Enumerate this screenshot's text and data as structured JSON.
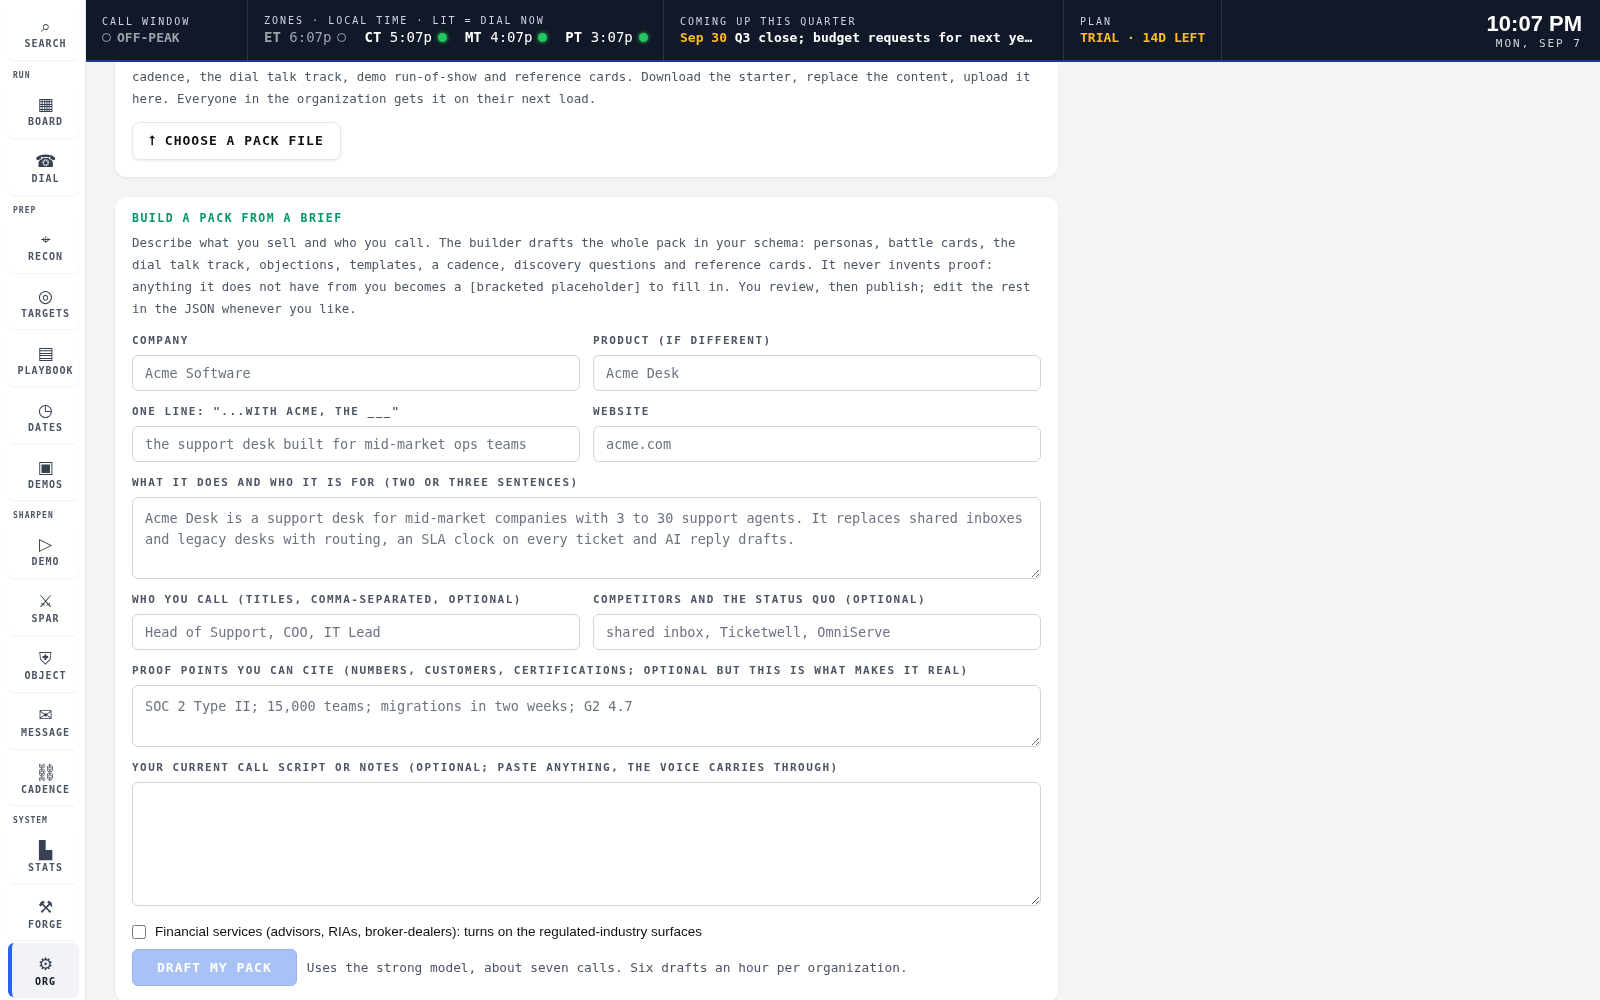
{
  "sidebar": {
    "search": {
      "icon": "⌕",
      "label": "SEARCH"
    },
    "sections": [
      {
        "title": "RUN",
        "items": [
          {
            "icon": "▦",
            "label": "BOARD",
            "selected": false
          },
          {
            "icon": "☎",
            "label": "DIAL",
            "selected": false
          }
        ]
      },
      {
        "title": "PREP",
        "items": [
          {
            "icon": "⌖",
            "label": "RECON",
            "selected": false
          },
          {
            "icon": "◎",
            "label": "TARGETS",
            "selected": false
          },
          {
            "icon": "▤",
            "label": "PLAYBOOK",
            "selected": false
          },
          {
            "icon": "◷",
            "label": "DATES",
            "selected": false
          },
          {
            "icon": "▣",
            "label": "DEMOS",
            "selected": false
          }
        ]
      },
      {
        "title": "SHARPEN",
        "items": [
          {
            "icon": "▷",
            "label": "DEMO",
            "selected": false
          },
          {
            "icon": "⚔",
            "label": "SPAR",
            "selected": false
          },
          {
            "icon": "⛨",
            "label": "OBJECT",
            "selected": false
          },
          {
            "icon": "✉",
            "label": "MESSAGE",
            "selected": false
          },
          {
            "icon": "⛓",
            "label": "CADENCE",
            "selected": false
          }
        ]
      },
      {
        "title": "SYSTEM",
        "items": [
          {
            "icon": "▙",
            "label": "STATS",
            "selected": false
          },
          {
            "icon": "⚒",
            "label": "FORGE",
            "selected": false
          },
          {
            "icon": "⚙",
            "label": "ORG",
            "selected": true
          }
        ]
      }
    ]
  },
  "header": {
    "call_window": {
      "label": "CALL WINDOW",
      "value": "OFF-PEAK",
      "lit": false
    },
    "zones": {
      "label": "ZONES · LOCAL TIME · LIT = DIAL NOW",
      "items": [
        {
          "zone": "ET",
          "time": "6:07p",
          "lit": false
        },
        {
          "zone": "CT",
          "time": "5:07p",
          "lit": true
        },
        {
          "zone": "MT",
          "time": "4:07p",
          "lit": true
        },
        {
          "zone": "PT",
          "time": "3:07p",
          "lit": true
        }
      ]
    },
    "coming_up": {
      "label": "COMING UP THIS QUARTER",
      "date": "Sep 30",
      "text": "Q3 close; budget requests for next ye…"
    },
    "plan": {
      "label": "PLAN",
      "value": "TRIAL · 14D LEFT"
    },
    "clock": {
      "time": "10:07 PM",
      "date": "MON, SEP 7"
    }
  },
  "upload_card": {
    "text": "cadence, the dial talk track, demo run-of-show and reference cards. Download the starter, replace the content, upload it here. Everyone in the organization gets it on their next load.",
    "button": "⭡ CHOOSE A PACK FILE"
  },
  "brief_card": {
    "title": "BUILD A PACK FROM A BRIEF",
    "text": "Describe what you sell and who you call. The builder drafts the whole pack in your schema: personas, battle cards, the dial talk track, objections, templates, a cadence, discovery questions and reference cards. It never invents proof: anything it does not have from you becomes a [bracketed placeholder] to fill in. You review, then publish; edit the rest in the JSON whenever you like.",
    "rows": [
      [
        {
          "kind": "input",
          "label": "COMPANY",
          "placeholder": "Acme Software"
        },
        {
          "kind": "input",
          "label": "PRODUCT (IF DIFFERENT)",
          "placeholder": "Acme Desk"
        }
      ],
      [
        {
          "kind": "input",
          "label": "ONE LINE: \"...WITH ACME, THE ___\"",
          "placeholder": "the support desk built for mid-market ops teams"
        },
        {
          "kind": "input",
          "label": "WEBSITE",
          "placeholder": "acme.com"
        }
      ],
      [
        {
          "kind": "textarea",
          "label": "WHAT IT DOES AND WHO IT IS FOR (TWO OR THREE SENTENCES)",
          "placeholder": "Acme Desk is a support desk for mid-market companies with 3 to 30 support agents. It replaces shared inboxes and legacy desks with routing, an SLA clock on every ticket and AI reply drafts."
        }
      ],
      [
        {
          "kind": "input",
          "label": "WHO YOU CALL (TITLES, COMMA-SEPARATED, OPTIONAL)",
          "placeholder": "Head of Support, COO, IT Lead"
        },
        {
          "kind": "input",
          "label": "COMPETITORS AND THE STATUS QUO (OPTIONAL)",
          "placeholder": "shared inbox, Ticketwell, OmniServe"
        }
      ],
      [
        {
          "kind": "textarea",
          "label": "PROOF POINTS YOU CAN CITE (NUMBERS, CUSTOMERS, CERTIFICATIONS; OPTIONAL BUT THIS IS WHAT MAKES IT REAL)",
          "placeholder": "SOC 2 Type II; 15,000 teams; migrations in two weeks; G2 4.7"
        }
      ],
      [
        {
          "kind": "bigtextarea",
          "label": "YOUR CURRENT CALL SCRIPT OR NOTES (OPTIONAL; PASTE ANYTHING, THE VOICE CARRIES THROUGH)"
        }
      ]
    ],
    "checkbox": {
      "label": "Financial services (advisors, RIAs, broker-dealers): turns on the regulated-industry surfaces",
      "checked": false
    },
    "button": {
      "label": "DRAFT MY PACK",
      "disabled": true
    },
    "note": "Uses the strong model, about seven calls. Six drafts an hour per organization."
  }
}
